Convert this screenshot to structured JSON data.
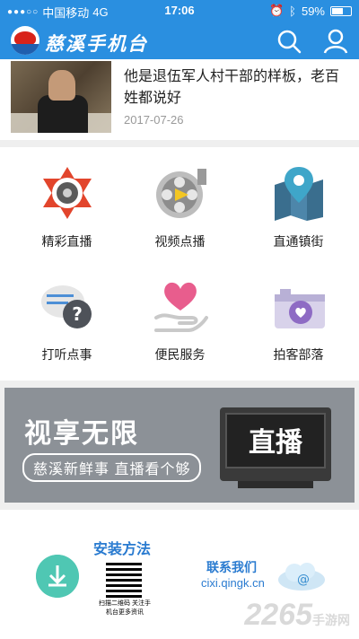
{
  "status": {
    "carrier": "中国移动",
    "network": "4G",
    "time": "17:06",
    "battery": "59%"
  },
  "header": {
    "brand": "慈溪手机台",
    "brand_color": "#2a8fe0"
  },
  "news": {
    "title": "他是退伍军人村干部的样板，老百姓都说好",
    "date": "2017-07-26"
  },
  "grid": [
    {
      "label": "精彩直播",
      "icon": "live-camera-icon"
    },
    {
      "label": "视频点播",
      "icon": "film-reel-icon"
    },
    {
      "label": "直通镇街",
      "icon": "map-pin-icon"
    },
    {
      "label": "打听点事",
      "icon": "question-chat-icon"
    },
    {
      "label": "便民服务",
      "icon": "heart-hand-icon"
    },
    {
      "label": "拍客部落",
      "icon": "camera-icon"
    }
  ],
  "banner": {
    "title": "视享无限",
    "subtitle": "慈溪新鲜事 直播看个够",
    "tv_text": "直播"
  },
  "footer": {
    "install": "安装方法",
    "qr_caption": "扫描二维码 关注手机台更多资讯",
    "contact": "联系我们",
    "site": "cixi.qingk.cn"
  },
  "watermark": {
    "brand": "2265",
    "suffix": "手游网"
  }
}
